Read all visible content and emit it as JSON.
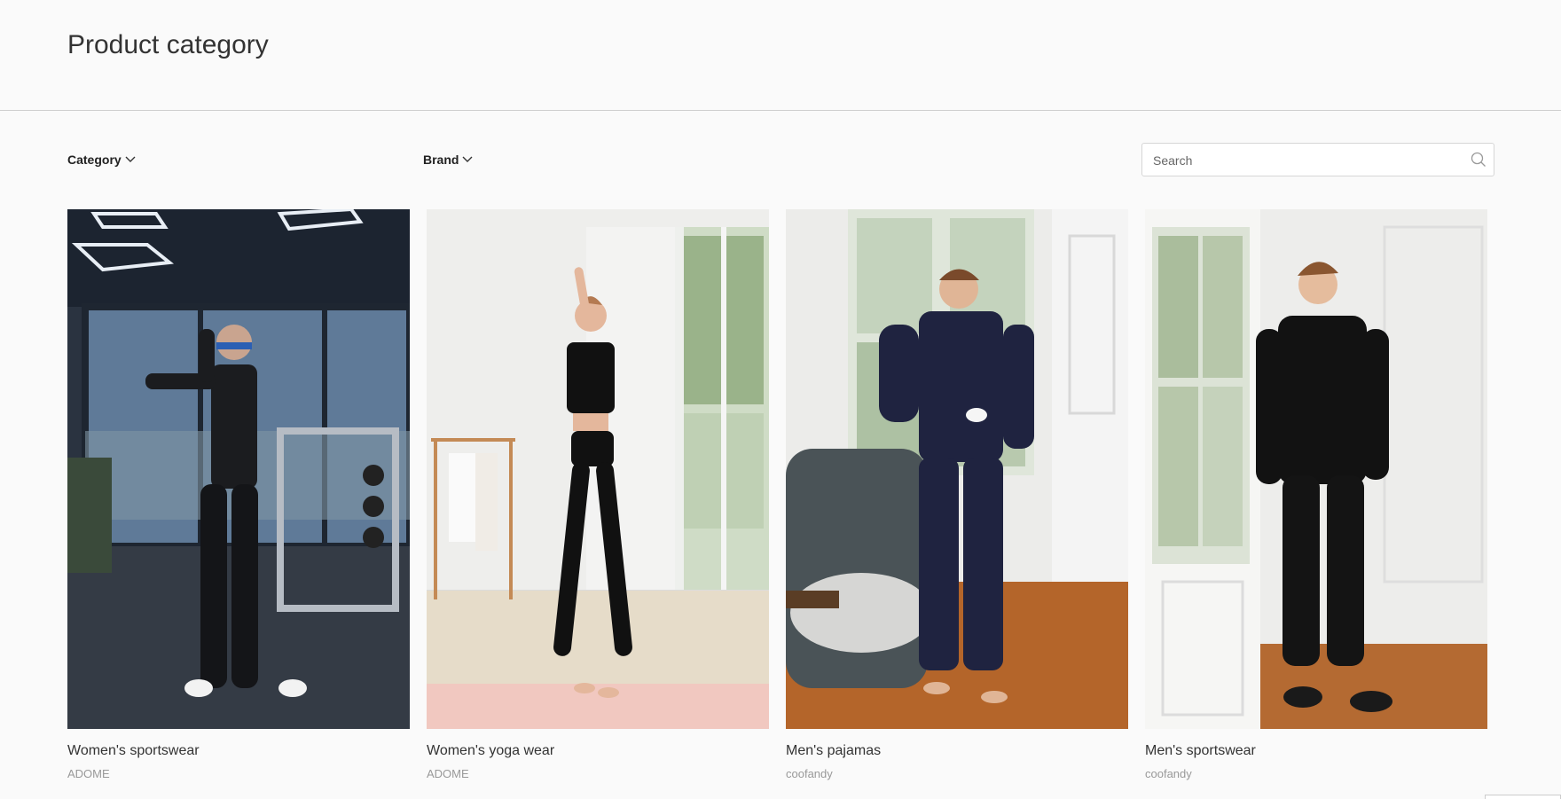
{
  "page": {
    "title": "Product category"
  },
  "filters": {
    "category_label": "Category",
    "brand_label": "Brand",
    "chevron_icon": "chevron-down-icon"
  },
  "search": {
    "placeholder": "Search",
    "value": "",
    "icon": "search-icon"
  },
  "products": [
    {
      "name": "Women's sportswear",
      "brand": "ADOME"
    },
    {
      "name": "Women's yoga wear",
      "brand": "ADOME"
    },
    {
      "name": "Men's pajamas",
      "brand": "coofandy"
    },
    {
      "name": "Men's sportswear",
      "brand": "coofandy"
    }
  ],
  "colors": {
    "background": "#fafafa",
    "text": "#333333",
    "muted": "#999999",
    "divider": "#cfcfcf"
  }
}
